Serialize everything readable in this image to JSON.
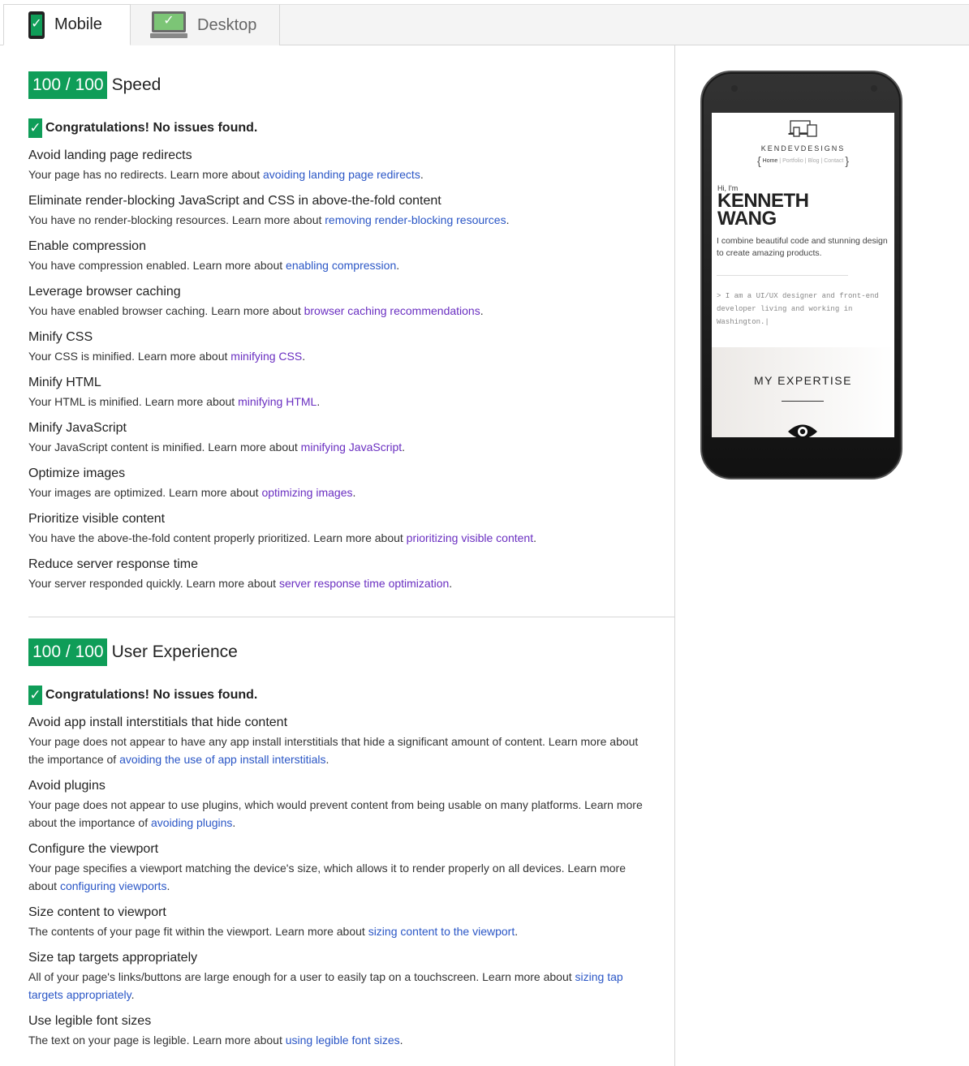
{
  "tabs": [
    {
      "label": "Mobile",
      "icon": "mobile-phone-check-icon"
    },
    {
      "label": "Desktop",
      "icon": "desktop-monitor-check-icon"
    }
  ],
  "speed": {
    "score": "100 / 100",
    "category": "Speed",
    "congrats": "Congratulations! No issues found.",
    "rules": [
      {
        "title": "Avoid landing page redirects",
        "text": "Your page has no redirects. Learn more about ",
        "link": "avoiding landing page redirects",
        "end": "."
      },
      {
        "title": "Eliminate render-blocking JavaScript and CSS in above-the-fold content",
        "text": "You have no render-blocking resources. Learn more about ",
        "link": "removing render-blocking resources",
        "end": "."
      },
      {
        "title": "Enable compression",
        "text": "You have compression enabled. Learn more about ",
        "link": "enabling compression",
        "end": "."
      },
      {
        "title": "Leverage browser caching",
        "text": "You have enabled browser caching. Learn more about ",
        "link": "browser caching recommendations",
        "end": "."
      },
      {
        "title": "Minify CSS",
        "text": "Your CSS is minified. Learn more about ",
        "link": "minifying CSS",
        "end": "."
      },
      {
        "title": "Minify HTML",
        "text": "Your HTML is minified. Learn more about ",
        "link": "minifying HTML",
        "end": "."
      },
      {
        "title": "Minify JavaScript",
        "text": "Your JavaScript content is minified. Learn more about ",
        "link": "minifying JavaScript",
        "end": "."
      },
      {
        "title": "Optimize images",
        "text": "Your images are optimized. Learn more about ",
        "link": "optimizing images",
        "end": "."
      },
      {
        "title": "Prioritize visible content",
        "text": "You have the above-the-fold content properly prioritized. Learn more about ",
        "link": "prioritizing visible content",
        "end": "."
      },
      {
        "title": "Reduce server response time",
        "text": "Your server responded quickly. Learn more about ",
        "link": "server response time optimization",
        "end": "."
      }
    ]
  },
  "ux": {
    "score": "100 / 100",
    "category": "User Experience",
    "congrats": "Congratulations! No issues found.",
    "rules": [
      {
        "title": "Avoid app install interstitials that hide content",
        "text": "Your page does not appear to have any app install interstitials that hide a significant amount of content. Learn more about the importance of ",
        "link": "avoiding the use of app install interstitials",
        "end": "."
      },
      {
        "title": "Avoid plugins",
        "text": "Your page does not appear to use plugins, which would prevent content from being usable on many platforms. Learn more about the importance of ",
        "link": "avoiding plugins",
        "end": "."
      },
      {
        "title": "Configure the viewport",
        "text": "Your page specifies a viewport matching the device's size, which allows it to render properly on all devices. Learn more about ",
        "link": "configuring viewports",
        "end": "."
      },
      {
        "title": "Size content to viewport",
        "text": "The contents of your page fit within the viewport. Learn more about ",
        "link": "sizing content to the viewport",
        "end": "."
      },
      {
        "title": "Size tap targets appropriately",
        "text": "All of your page's links/buttons are large enough for a user to easily tap on a touchscreen. Learn more about ",
        "link": "sizing tap targets appropriately",
        "end": "."
      },
      {
        "title": "Use legible font sizes",
        "text": "The text on your page is legible. Learn more about ",
        "link": "using legible font sizes",
        "end": "."
      }
    ]
  },
  "preview": {
    "brand": "KENDEVDESIGNS",
    "nav": [
      "Home",
      "Portfolio",
      "Blog",
      "Contact"
    ],
    "nav_separator": "|",
    "bracket_open": "{",
    "bracket_close": "}",
    "greeting": "Hi, I'm",
    "name_line1": "KENNETH",
    "name_line2": "WANG",
    "tagline": "I combine beautiful code and stunning design to create amazing products.",
    "code": "> I am a UI/UX designer and front-end developer living and working in Washington.|",
    "expertise": "MY EXPERTISE"
  },
  "colors": {
    "score_green": "#0f9d58",
    "link": "#2a56c6",
    "visited_link": "#6a2fc1"
  }
}
